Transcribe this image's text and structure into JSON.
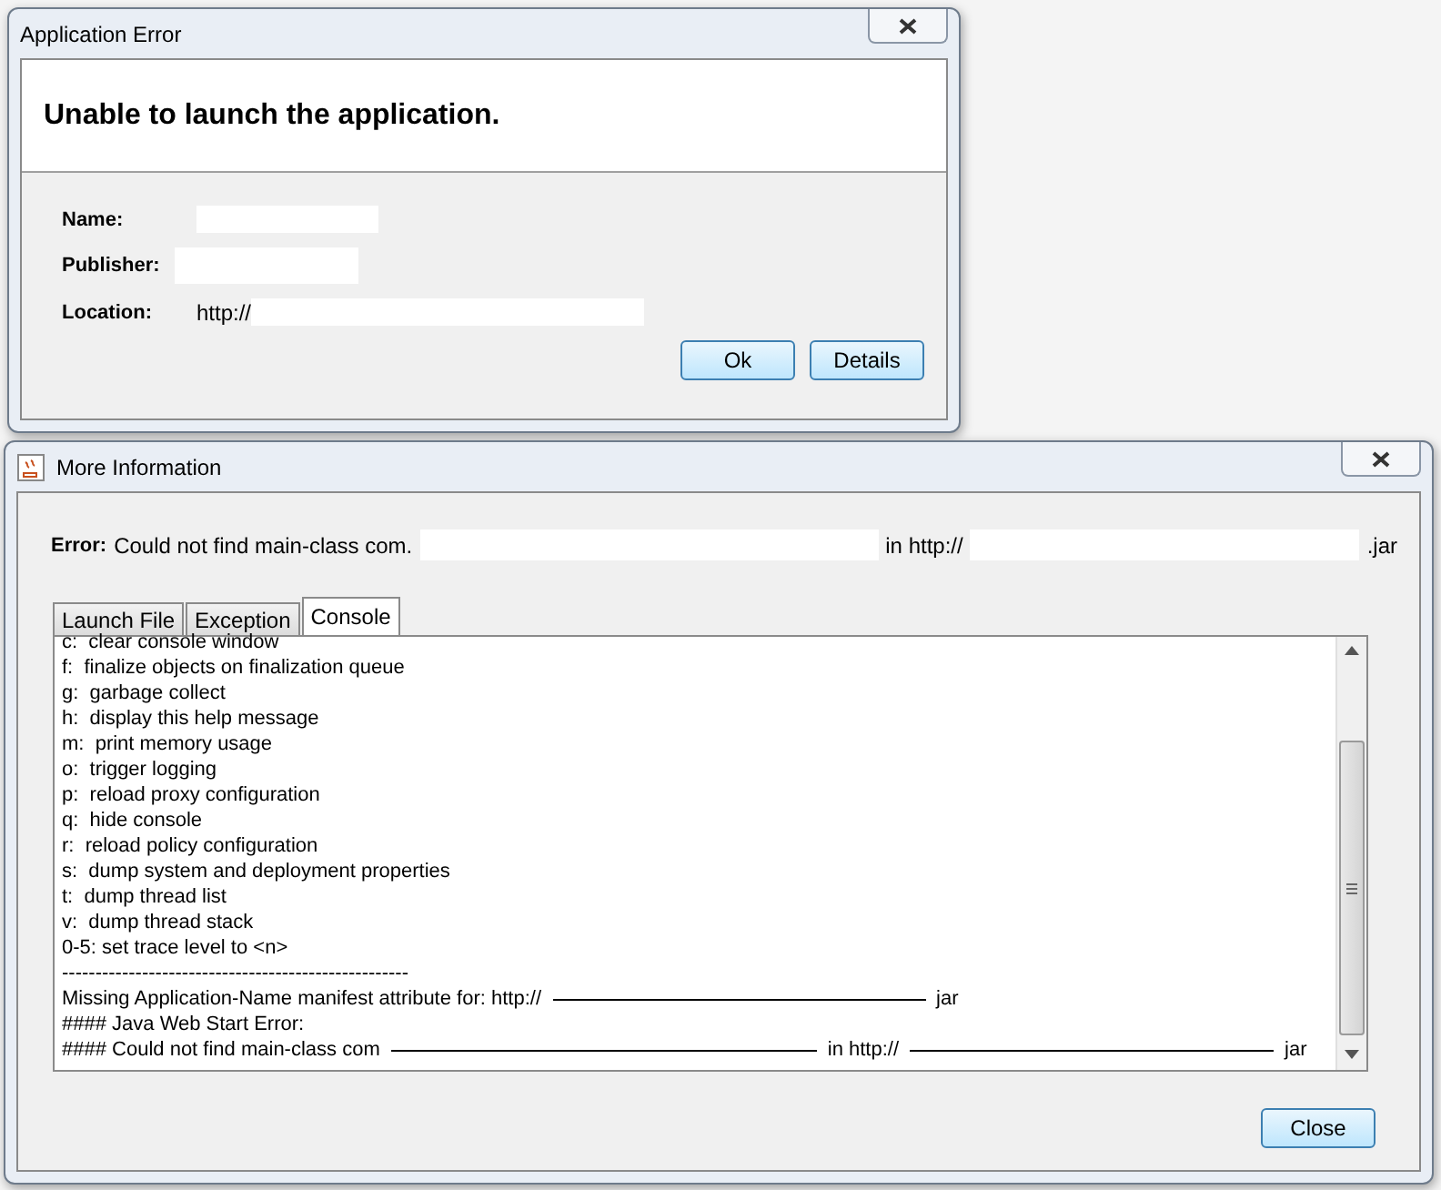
{
  "error_dialog": {
    "title": "Application Error",
    "heading": "Unable to launch the application.",
    "fields": [
      {
        "label": "Name:"
      },
      {
        "label": "Publisher:"
      },
      {
        "label": "Location:",
        "value": "http://"
      }
    ],
    "buttons": [
      "Ok",
      "Details"
    ]
  },
  "info_dialog": {
    "title": "More Information",
    "error_label": "Error:",
    "error_parts": [
      "Could not find main-class com.",
      "in http://",
      ".jar"
    ],
    "tabs": [
      {
        "label": "Launch File",
        "selected": false
      },
      {
        "label": "Exception",
        "selected": false
      },
      {
        "label": "Console",
        "selected": true
      }
    ],
    "console_lines": [
      [
        "c:  clear console window"
      ],
      [
        "f:  finalize objects on finalization queue"
      ],
      [
        "g:  garbage collect"
      ],
      [
        "h:  display this help message"
      ],
      [
        "m:  print memory usage"
      ],
      [
        "o:  trigger logging"
      ],
      [
        "p:  reload proxy configuration"
      ],
      [
        "q:  hide console"
      ],
      [
        "r:  reload policy configuration"
      ],
      [
        "s:  dump system and deployment properties"
      ],
      [
        "t:  dump thread list"
      ],
      [
        "v:  dump thread stack"
      ],
      [
        "0-5: set trace level to <n>"
      ],
      [
        "----------------------------------------------------"
      ],
      [
        "Missing Application-Name manifest attribute for: http://",
        "jar"
      ],
      [
        "#### Java Web Start Error:"
      ],
      [
        "#### Could not find main-class com",
        "in http://",
        "jar"
      ]
    ],
    "close_button": "Close"
  }
}
